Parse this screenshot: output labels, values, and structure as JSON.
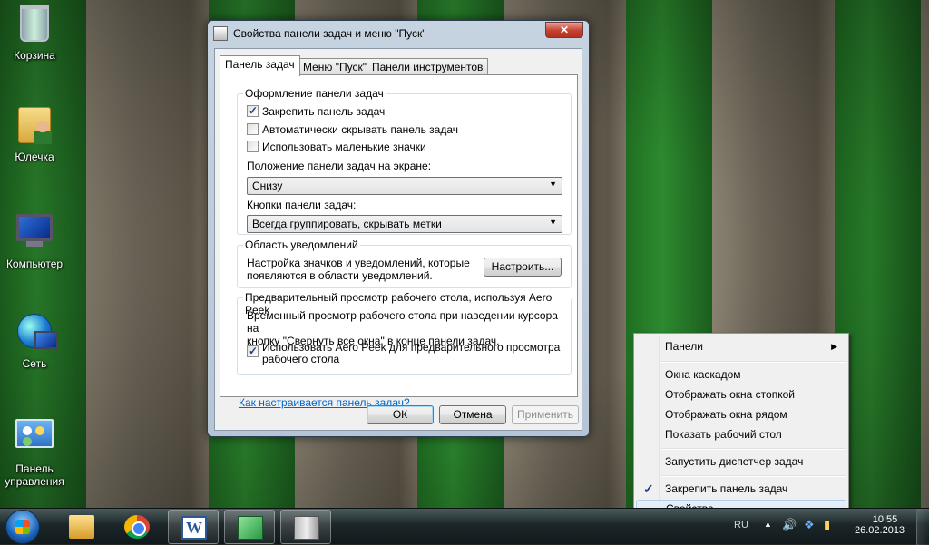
{
  "desktop": {
    "icons": [
      {
        "label": "Корзина",
        "icon": "recycle-bin-icon"
      },
      {
        "label": "Юлечка",
        "icon": "user-folder-icon"
      },
      {
        "label": "Компьютер",
        "icon": "computer-icon"
      },
      {
        "label": "Сеть",
        "icon": "network-icon"
      },
      {
        "label": "Панель управления",
        "icon": "control-panel-icon"
      }
    ]
  },
  "dialog": {
    "title": "Свойства панели задач и меню \"Пуск\"",
    "close_label": "✕",
    "tabs": [
      {
        "label": "Панель задач",
        "active": true
      },
      {
        "label": "Меню \"Пуск\"",
        "active": false
      },
      {
        "label": "Панели инструментов",
        "active": false
      }
    ],
    "appearance": {
      "title": "Оформление панели задач",
      "lock_taskbar": {
        "label": "Закрепить панель задач",
        "checked": true
      },
      "autohide": {
        "label": "Автоматически скрывать панель задач",
        "checked": false
      },
      "small_icons": {
        "label": "Использовать маленькие значки",
        "checked": false
      },
      "position_label": "Положение панели задач на экране:",
      "position_value": "Снизу",
      "buttons_label": "Кнопки панели задач:",
      "buttons_value": "Всегда группировать, скрывать метки"
    },
    "notifications": {
      "title": "Область уведомлений",
      "text_line1": "Настройка значков и уведомлений, которые",
      "text_line2": "появляются в области уведомлений.",
      "customize_button": "Настроить..."
    },
    "aero_peek": {
      "title": "Предварительный просмотр рабочего стола, используя Aero Peek",
      "text_line1": "Временный просмотр рабочего стола при наведении курсора на",
      "text_line2": "кнопку \"Свернуть все окна\" в конце панели задач.",
      "use_peek_line1": "Использовать Aero Peek для предварительного просмотра",
      "use_peek_line2": "рабочего стола",
      "use_peek_checked": true
    },
    "help_link": "Как настраивается панель задач?",
    "ok_button": "ОК",
    "cancel_button": "Отмена",
    "apply_button": "Применить"
  },
  "context_menu": {
    "panels": "Панели",
    "cascade": "Окна каскадом",
    "stacked": "Отображать окна стопкой",
    "side_by_side": "Отображать окна рядом",
    "show_desktop": "Показать рабочий стол",
    "task_manager": "Запустить диспетчер задач",
    "lock_taskbar": "Закрепить панель задач",
    "lock_taskbar_checked": true,
    "properties": "Свойства"
  },
  "taskbar": {
    "language": "RU",
    "time": "10:55",
    "date": "26.02.2013",
    "tray_arrow": "▲",
    "apps": [
      {
        "name": "explorer",
        "icon": "folder-icon",
        "running": false
      },
      {
        "name": "chrome",
        "icon": "chrome-icon",
        "running": false
      },
      {
        "name": "word",
        "icon": "word-icon",
        "running": true
      },
      {
        "name": "app-green",
        "icon": "green-app-icon",
        "running": true
      },
      {
        "name": "taskbar-props",
        "icon": "tower-icon",
        "running": true
      }
    ]
  },
  "colors": {
    "link": "#0066cc",
    "accent_check": "#26406f"
  }
}
